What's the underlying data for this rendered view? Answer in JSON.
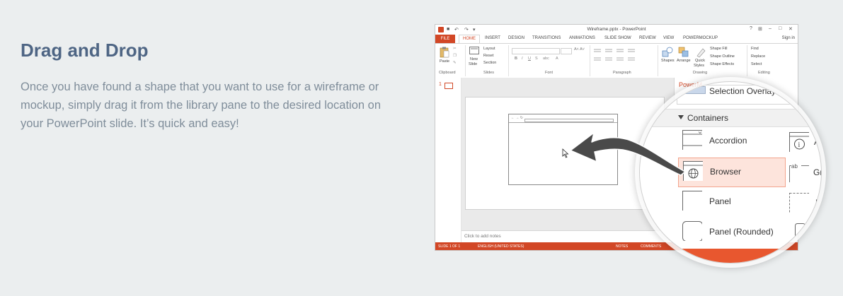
{
  "section": {
    "heading": "Drag and Drop",
    "description": "Once you have found a shape that you want to use for a wireframe or mockup, simply drag it from the library pane to the desired location on your PowerPoint slide. It’s quick and easy!"
  },
  "window": {
    "title": "Wireframe.pptx - PowerPoint",
    "controls": [
      "?",
      "⊞",
      "–",
      "□",
      "✕"
    ],
    "sign_in": "Sign in"
  },
  "ribbon_tabs": {
    "file": "FILE",
    "home": "HOME",
    "others": [
      "INSERT",
      "DESIGN",
      "TRANSITIONS",
      "ANIMATIONS",
      "SLIDE SHOW",
      "REVIEW",
      "VIEW",
      "POWERMOCKUP"
    ]
  },
  "ribbon": {
    "paste": "Paste",
    "new_slide": "New",
    "new_slide2": "Slide",
    "layout": "Layout",
    "reset": "Reset",
    "section": "Section",
    "shapes": "Shapes",
    "arrange": "Arrange",
    "quick": "Quick",
    "styles": "Styles",
    "shape_fill": "Shape Fill",
    "shape_outline": "Shape Outline",
    "shape_effects": "Shape Effects",
    "find": "Find",
    "replace": "Replace",
    "select": "Select",
    "groups": [
      "Clipboard",
      "Slides",
      "Font",
      "Paragraph",
      "Drawing",
      "Editing"
    ]
  },
  "slide_pane": {
    "slide_number": "1"
  },
  "notes": {
    "placeholder": "Click to add notes"
  },
  "status_bar": {
    "slide": "SLIDE 1 OF 1",
    "language": "ENGLISH (UNITED STATES)",
    "notes": "NOTES",
    "comments": "COMMENTS"
  },
  "library_pane": {
    "title": "PowerM",
    "selection": "Selection Overlay",
    "category": "Containers",
    "items": [
      "Accordion",
      "Browser",
      "Panel",
      "Panel (Rounded)"
    ],
    "right_partial": [
      "A",
      "Gr",
      "P"
    ],
    "selected_item": "Browser"
  },
  "colors": {
    "accent": "#d24726",
    "heading": "#4e6584",
    "body_text": "#7f8d9a",
    "selection": "#fde4dc",
    "background": "#ebeeef"
  },
  "icons": [
    "app-icon",
    "save-icon",
    "undo-icon",
    "redo-icon",
    "paste-icon",
    "globe-icon",
    "info-icon",
    "arrow-icon",
    "cursor-icon"
  ]
}
